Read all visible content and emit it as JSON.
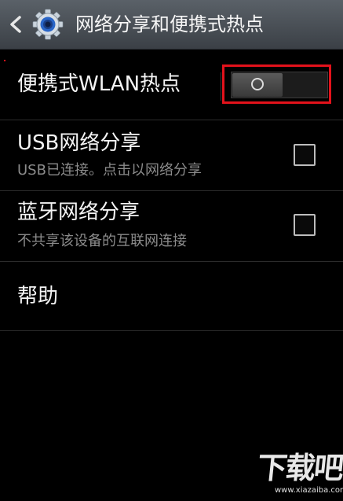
{
  "header": {
    "title": "网络分享和便携式热点",
    "back_icon": "chevron-left-icon",
    "app_icon": "gear-icon"
  },
  "rows": [
    {
      "title": "便携式WLAN热点",
      "control": "toggle",
      "toggle_state": "off"
    },
    {
      "title": "USB网络分享",
      "subtitle": "USB已连接。点击以网络分享",
      "control": "checkbox",
      "checked": false
    },
    {
      "title": "蓝牙网络分享",
      "subtitle": "不共享该设备的互联网连接",
      "control": "checkbox",
      "checked": false
    },
    {
      "title": "帮助"
    }
  ],
  "watermark": {
    "logo_text": "下载吧",
    "url": "www.xiazaiba.com"
  },
  "colors": {
    "header_bg": "#4a5056",
    "highlight": "#e3121b",
    "background": "#000000"
  }
}
